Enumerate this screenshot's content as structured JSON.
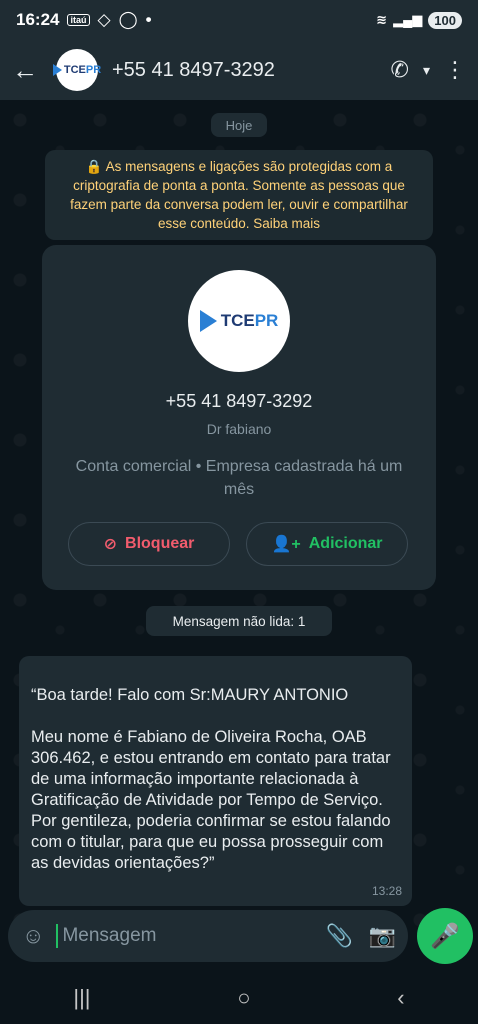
{
  "status_bar": {
    "time": "16:24",
    "bank_label": "itaú",
    "battery": "100"
  },
  "header": {
    "title": "+55 41 8497-3292"
  },
  "date_chip": "Hoje",
  "encryption_notice": "🔒 As mensagens e ligações são protegidas com a criptografia de ponta a ponta. Somente as pessoas que fazem parte da conversa podem ler, ouvir e compartilhar esse conteúdo. Saiba mais",
  "contact_card": {
    "avatar_text": "TCE",
    "avatar_text_pr": "PR",
    "phone": "+55 41 8497-3292",
    "name": "Dr fabiano",
    "info": "Conta comercial • Empresa cadastrada há um mês",
    "block_label": "Bloquear",
    "add_label": "Adicionar"
  },
  "unread_chip": "Mensagem não lida: 1",
  "message": {
    "text": "“Boa tarde! Falo com Sr:MAURY ANTONIO\n\nMeu nome é Fabiano de Oliveira Rocha, OAB 306.462, e estou  entrando em contato para tratar de uma informação importante relacionada à Gratificação de Atividade por Tempo de Serviço.\nPor gentileza, poderia confirmar se estou falando com o titular, para que eu possa prosseguir com as devidas orientações?”",
    "time": "13:28"
  },
  "composer": {
    "placeholder": "Mensagem"
  },
  "colors": {
    "accent": "#21c063",
    "danger": "#f15c6d",
    "notice": "#ffd279"
  }
}
